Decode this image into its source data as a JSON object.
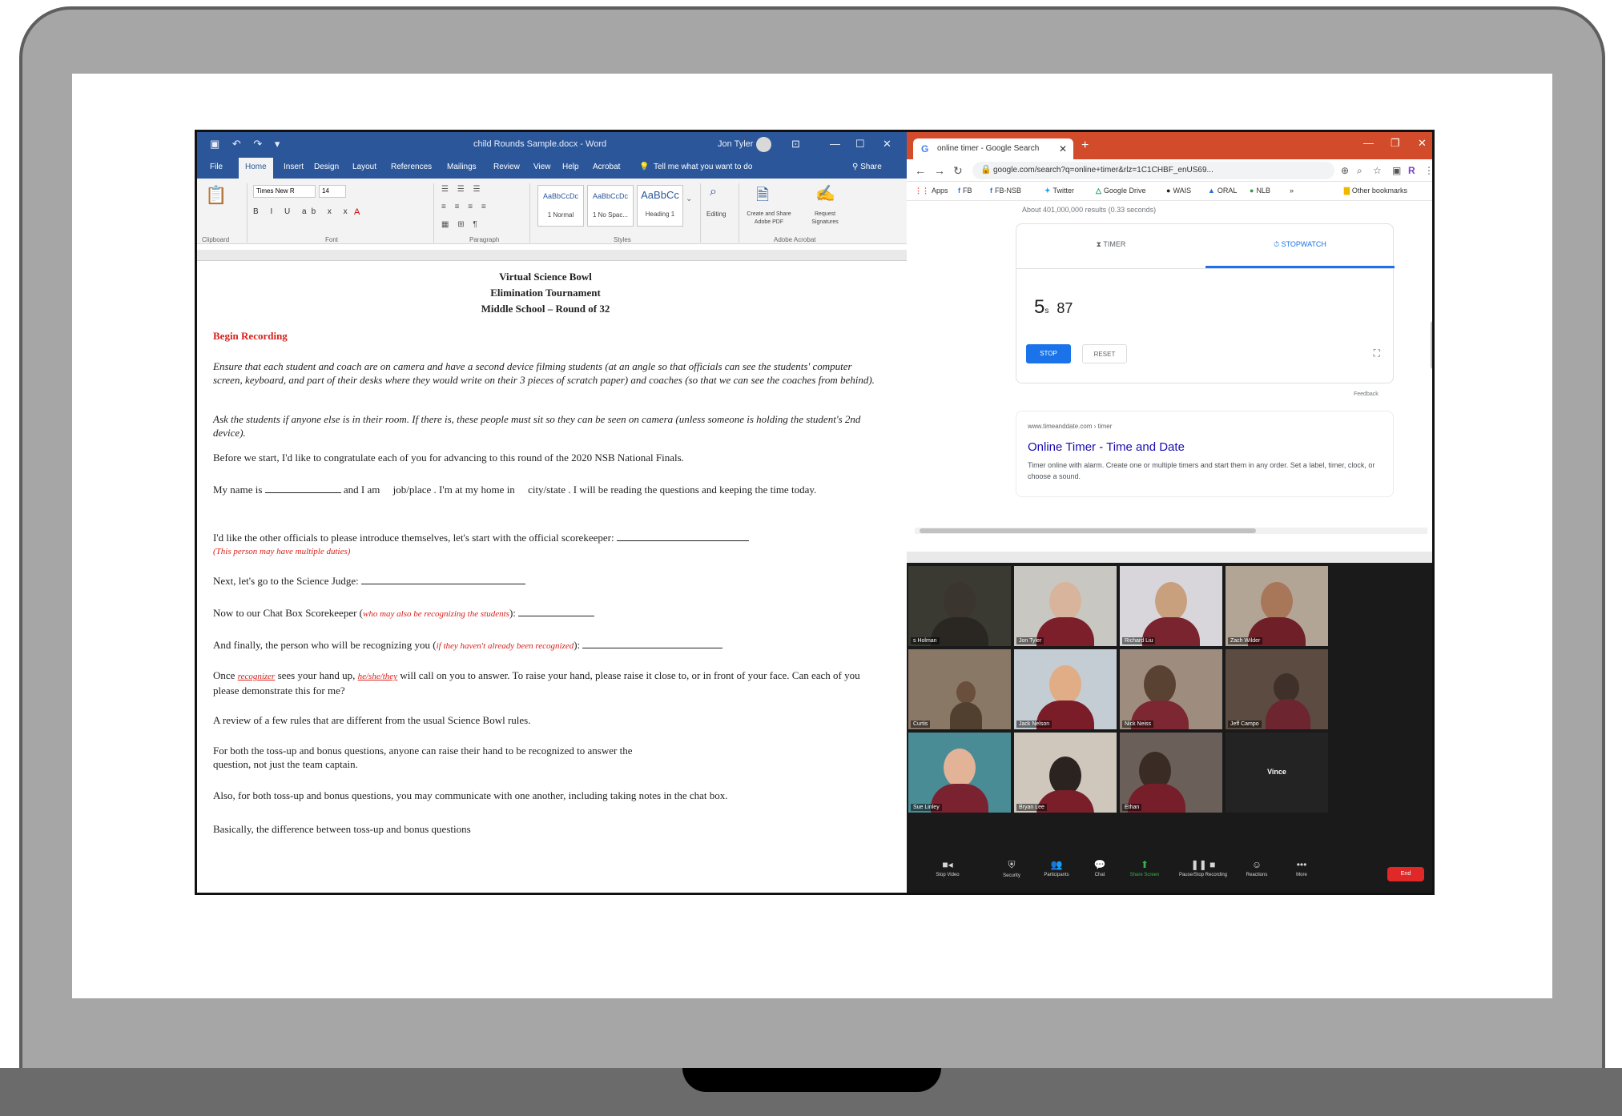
{
  "colors": {
    "word_blue": "#2b579a",
    "chrome_orange": "#d24b2a",
    "google_blue": "#1a73e8",
    "zoom_end_red": "#e02828"
  },
  "word": {
    "title": "child Rounds Sample.docx - Word",
    "user": "Jon Tyler",
    "tabs": [
      "File",
      "Home",
      "Insert",
      "Design",
      "Layout",
      "References",
      "Mailings",
      "Review",
      "View",
      "Help",
      "Acrobat"
    ],
    "tell_me": "Tell me what you want to do",
    "share": "Share",
    "ribbon": {
      "font_name": "Times New R",
      "font_size": "14",
      "groups": [
        "Clipboard",
        "Font",
        "Paragraph",
        "Styles",
        "Adobe Acrobat"
      ],
      "styles": [
        {
          "sample": "AaBbCcDc",
          "name": "1 Normal"
        },
        {
          "sample": "AaBbCcDc",
          "name": "1 No Spac..."
        },
        {
          "sample": "AaBbCc",
          "name": "Heading 1"
        }
      ],
      "editing": "Editing",
      "acrobat_create": "Create and Share Adobe PDF",
      "acrobat_sign": "Request Signatures"
    },
    "doc": {
      "title_lines": [
        "Virtual Science Bowl",
        "Elimination Tournament",
        "Middle School – Round of 32"
      ],
      "begin": "Begin Recording",
      "para1": "Ensure that each student and coach are on camera and have a second device filming students (at an angle so that officials can see the students' computer screen, keyboard, and part of their desks where they would write on their 3 pieces of scratch paper) and coaches (so that we can see the coaches from behind).",
      "para2": "Ask the students if anyone else is in their room. If there is, these people must sit so they can be seen on camera (unless someone is holding the student's 2nd device).",
      "para3": "Before we start, I'd like to congratulate each of you for advancing to this round of the 2020 NSB National Finals.",
      "para4_a": "My name is",
      "para4_b": "and I am",
      "para4_c": "job/place",
      "para4_d": ". I'm at my home in",
      "para4_e": "city/state",
      "para4_f": ". I will be reading the questions and keeping the time today.",
      "para5": "I'd like the other officials to please introduce themselves, let's start with the official scorekeeper:",
      "para5_note": "(This person may have multiple duties)",
      "para6": "Next, let's go to the Science Judge:",
      "para7_a": "Now to our Chat Box Scorekeeper (",
      "para7_note": "who may also be recognizing the students",
      "para7_b": "):",
      "para8_a": "And finally, the person who will be recognizing you (",
      "para8_note": "if they haven't already been recognized",
      "para8_b": "):",
      "para9_a": "Once",
      "para9_rec": "recognizer",
      "para9_b": "sees your hand up,",
      "para9_he": "he/she/they",
      "para9_c": "will call on you to answer.  To raise your hand, please raise it close to, or in front of your face.  Can each of you please demonstrate this for me?",
      "para10": "A review of a few rules that are different from the usual Science Bowl rules.",
      "para11": "For both the toss-up and bonus questions, anyone can raise their hand to be recognized to answer the question, not just the team captain.",
      "para12": "Also, for both toss-up and bonus questions, you may communicate with one another, including taking notes in the chat box.",
      "para13": "Basically, the difference between toss-up and bonus questions"
    }
  },
  "chrome": {
    "tab_title": "online timer - Google Search",
    "url": "google.com/search?q=online+timer&rlz=1C1CHBF_enUS69...",
    "bookmarks": [
      "Apps",
      "FB",
      "FB-NSB",
      "Twitter",
      "Google Drive",
      "WAIS",
      "ORAL",
      "NLB",
      "Other bookmarks"
    ],
    "results_count": "About 401,000,000 results (0.33 seconds)",
    "timer_tab": "TIMER",
    "stopwatch_tab": "STOPWATCH",
    "time_main": "5",
    "time_unit": "s",
    "time_frac": "87",
    "stop_label": "STOP",
    "reset_label": "RESET",
    "feedback": "Feedback",
    "result_url": "www.timeanddate.com › timer",
    "result_title": "Online Timer - Time and Date",
    "result_snippet": "Timer online with alarm. Create one or multiple timers and start them in any order. Set a label, timer, clock, or choose a sound."
  },
  "zoom": {
    "participants": [
      "s Holman",
      "Jon Tyler",
      "Richard Liu",
      "Zach Wilder",
      "Curtis",
      "Jack Nelson",
      "Nick Neiss",
      "Jeff Campo",
      "Sue Linley",
      "Bryan Lee",
      "Ethan",
      "Vince"
    ],
    "toolbar": [
      "Stop Video",
      "Security",
      "Participants",
      "Chat",
      "Share Screen",
      "Pause/Stop Recording",
      "Reactions",
      "More"
    ],
    "end": "End"
  }
}
